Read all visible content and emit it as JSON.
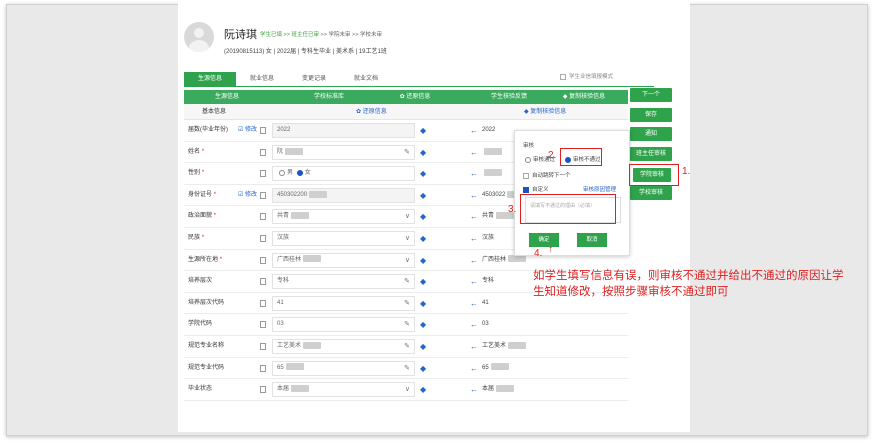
{
  "student": {
    "name": "阮诗琪",
    "breadcrumb_active": "学生已填 >> 班主任已审",
    "breadcrumb_rest": " >> 学院未审 >> 学校未审",
    "info": "(20190815113)  女  | 2022届  | 专科生毕业  | 美术系  | 19工艺1班"
  },
  "tabs": [
    {
      "label": "生源信息",
      "active": true
    },
    {
      "label": "就业信息",
      "active": false
    },
    {
      "label": "变更记录",
      "active": false
    },
    {
      "label": "就业文档",
      "active": false
    }
  ],
  "check_mode_label": "学生业信填报模式",
  "table": {
    "head_col1": "生源信息",
    "head_col2": "学校标准库",
    "head_col2_action": "✿ 还原信息",
    "head_col3": "学生核验反馈",
    "head_col3_action": "◆ 复制核验信息",
    "sub_col1": "基本信息",
    "sub_col2": "✿ 还原信息",
    "sub_col3": "◆ 复制核验信息",
    "edit_label": "修改",
    "rows": [
      {
        "label": "届数(毕业年份)",
        "required": false,
        "edit": true,
        "value": "2022",
        "blur": false,
        "icon": "",
        "right": "2022",
        "right_blur": false,
        "gray": true
      },
      {
        "label": "姓名",
        "required": true,
        "edit": false,
        "value": "阮",
        "blur": true,
        "icon": "✎",
        "right": "",
        "right_blur": true,
        "gray": false
      },
      {
        "label": "性别",
        "required": true,
        "edit": false,
        "value": "",
        "blur": false,
        "icon": "",
        "right": "",
        "right_blur": true,
        "gray": false,
        "radio": true,
        "radio_opt1": "男",
        "radio_opt2": "女"
      },
      {
        "label": "身份证号",
        "required": true,
        "edit": true,
        "value": "450302200",
        "blur": true,
        "icon": "",
        "right": "4503022",
        "right_blur": true,
        "gray": true
      },
      {
        "label": "政治面貌",
        "required": true,
        "edit": false,
        "value": "共青",
        "blur": true,
        "icon": "∨",
        "right": "共青",
        "right_blur": true,
        "gray": false
      },
      {
        "label": "民族",
        "required": true,
        "edit": false,
        "value": "汉族",
        "blur": false,
        "icon": "∨",
        "right": "汉族",
        "right_blur": false,
        "gray": false
      },
      {
        "label": "生源所在地",
        "required": true,
        "edit": false,
        "value": "广西桂林",
        "blur": true,
        "icon": "∨",
        "right": "广西桂林",
        "right_blur": true,
        "gray": false
      },
      {
        "label": "培养层次",
        "required": false,
        "edit": false,
        "value": "专科",
        "blur": false,
        "icon": "✎",
        "right": "专科",
        "right_blur": false,
        "gray": false
      },
      {
        "label": "培养层次代码",
        "required": false,
        "edit": false,
        "value": "41",
        "blur": false,
        "icon": "✎",
        "right": "41",
        "right_blur": false,
        "gray": false
      },
      {
        "label": "学院代码",
        "required": false,
        "edit": false,
        "value": "03",
        "blur": false,
        "icon": "✎",
        "right": "03",
        "right_blur": false,
        "gray": false
      },
      {
        "label": "规范专业名称",
        "required": false,
        "edit": false,
        "value": "工艺美术",
        "blur": true,
        "icon": "✎",
        "right": "工艺美术",
        "right_blur": true,
        "gray": false
      },
      {
        "label": "规范专业代码",
        "required": false,
        "edit": false,
        "value": "65",
        "blur": true,
        "icon": "✎",
        "right": "65",
        "right_blur": true,
        "gray": false
      },
      {
        "label": "毕业状态",
        "required": false,
        "edit": false,
        "value": "本届",
        "blur": true,
        "icon": "∨",
        "right": "本届",
        "right_blur": true,
        "gray": false
      }
    ]
  },
  "buttons": {
    "next": "下一个",
    "save": "保存",
    "notify": "通知",
    "head_teacher_review": "班主任审核",
    "college_review": "学院审核",
    "school_review": "学校审核"
  },
  "popup": {
    "title": "审核",
    "opt_pass": "审核通过",
    "opt_fail": "审核不通过",
    "auto_next": "自动跳转下一个",
    "custom": "自定义",
    "reason_manage": "审核原因管理",
    "reason_placeholder": "请填写不通过的理由（必填）",
    "confirm": "确定",
    "cancel": "取消"
  },
  "annotations": {
    "step1": "1.",
    "step2": "2.",
    "step3": "3.",
    "step4": "4.",
    "note": "如学生填写信息有误，则审核不通过并给出不通过的原因让学生知道修改，按照步骤审核不通过即可"
  },
  "colors": {
    "green": "#2fa34b",
    "annotation_red": "#e02020",
    "link_blue": "#2565c9"
  }
}
